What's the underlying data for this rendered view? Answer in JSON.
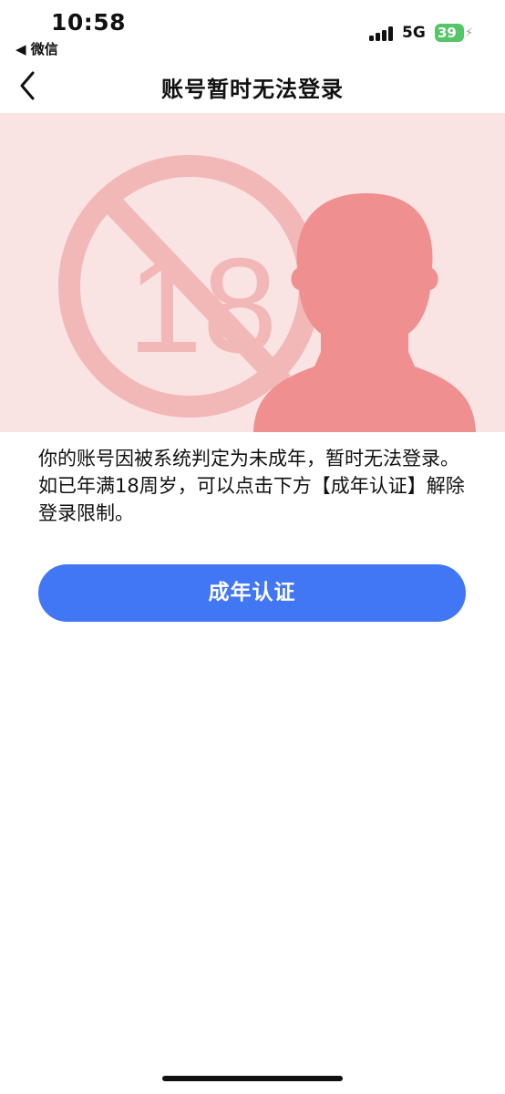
{
  "status_bar": {
    "time": "10:58",
    "back_app": "◀ 微信",
    "network": "5G",
    "battery": "39"
  },
  "nav": {
    "title": "账号暂时无法登录"
  },
  "banner": {
    "number": "18"
  },
  "notice": {
    "text": "你的账号因被系统判定为未成年，暂时无法登录。如已年满18周岁，可以点击下方【成年认证】解除登录限制。"
  },
  "action": {
    "verify_label": "成年认证"
  },
  "colors": {
    "accent": "#4176f5",
    "banner_bg": "#fae3e3",
    "prohibition": "#f2b7b7",
    "silhouette": "#ef8f8f",
    "battery": "#55c667"
  },
  "icons": {
    "back": "chevron-left-icon",
    "signal": "signal-bars-icon",
    "battery": "battery-icon",
    "prohibition": "no-under-18-icon",
    "person": "person-silhouette-icon"
  }
}
